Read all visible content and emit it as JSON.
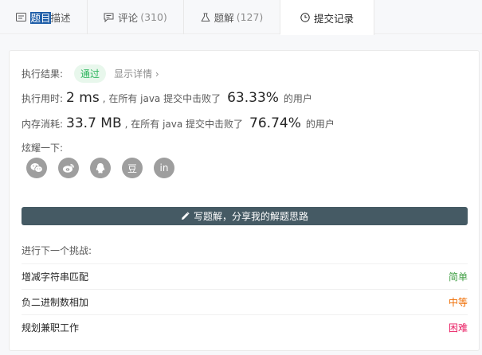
{
  "tabs": [
    {
      "label_sel": "题目",
      "label_rest": "描述",
      "icon": "document-icon"
    },
    {
      "label": "评论",
      "count": "(310)",
      "icon": "comment-icon"
    },
    {
      "label": "题解",
      "count": "(127)",
      "icon": "flask-icon"
    },
    {
      "label": "提交记录",
      "icon": "clock-icon"
    }
  ],
  "result": {
    "label": "执行结果:",
    "status": "通过",
    "detail_link": "显示详情",
    "status_color": "#2db55d"
  },
  "runtime": {
    "label": "执行用时:",
    "value": "2 ms",
    "middle": ", 在所有 java 提交中击败了",
    "percent": "63.33%",
    "suffix": "的用户"
  },
  "memory": {
    "label": "内存消耗:",
    "value": "33.7 MB",
    "middle": ", 在所有 java 提交中击败了",
    "percent": "76.74%",
    "suffix": "的用户"
  },
  "share": {
    "label": "炫耀一下:",
    "icons": [
      {
        "name": "wechat-icon",
        "glyph": ""
      },
      {
        "name": "weibo-icon",
        "glyph": ""
      },
      {
        "name": "qq-icon",
        "glyph": ""
      },
      {
        "name": "douban-icon",
        "glyph": "豆"
      },
      {
        "name": "linkedin-icon",
        "glyph": "in"
      }
    ]
  },
  "write_solution": {
    "label": "写题解，分享我的解题思路"
  },
  "next": {
    "label": "进行下一个挑战:",
    "items": [
      {
        "name": "增减字符串匹配",
        "difficulty": "简单",
        "color": "#43a047"
      },
      {
        "name": "负二进制数相加",
        "difficulty": "中等",
        "color": "#ef6c00"
      },
      {
        "name": "规划兼职工作",
        "difficulty": "困难",
        "color": "#e91e63"
      }
    ]
  }
}
